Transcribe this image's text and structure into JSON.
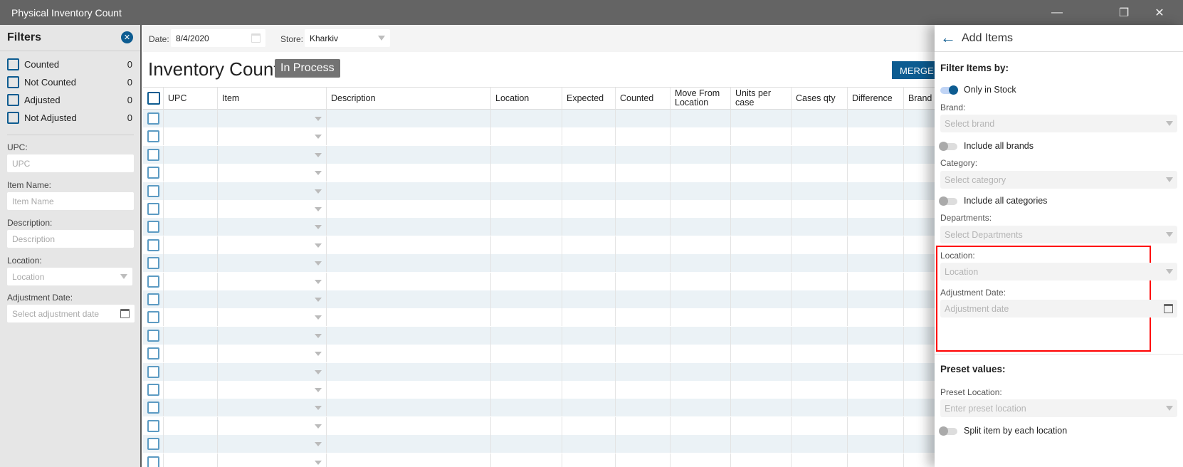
{
  "window": {
    "title": "Physical Inventory Count",
    "minimize": "—",
    "restore": "❐",
    "close": "✕"
  },
  "sidebar": {
    "title": "Filters",
    "close": "✕",
    "status_filters": [
      {
        "label": "Counted",
        "count": "0"
      },
      {
        "label": "Not Counted",
        "count": "0"
      },
      {
        "label": "Adjusted",
        "count": "0"
      },
      {
        "label": "Not Adjusted",
        "count": "0"
      }
    ],
    "fields": {
      "upc": {
        "label": "UPC:",
        "placeholder": "UPC"
      },
      "item_name": {
        "label": "Item Name:",
        "placeholder": "Item Name"
      },
      "description": {
        "label": "Description:",
        "placeholder": "Description"
      },
      "location": {
        "label": "Location:",
        "placeholder": "Location"
      },
      "adjustment_date": {
        "label": "Adjustment Date:",
        "placeholder": "Select adjustment date"
      }
    }
  },
  "toolbar": {
    "date_label": "Date:",
    "date_value": "8/4/2020",
    "store_label": "Store:",
    "store_value": "Kharkiv"
  },
  "main": {
    "title": "Inventory Count",
    "status": "In Process",
    "merge_button": "MERGE I"
  },
  "table": {
    "columns": [
      "UPC",
      "Item",
      "Description",
      "Location",
      "Expected",
      "Counted",
      "Move From Location",
      "Units per case",
      "Cases qty",
      "Difference",
      "Brand"
    ]
  },
  "panel": {
    "back": "←",
    "title": "Add Items",
    "filter_heading": "Filter Items by:",
    "only_in_stock": "Only in Stock",
    "brand_label": "Brand:",
    "brand_placeholder": "Select brand",
    "include_all_brands": "Include all brands",
    "category_label": "Category:",
    "category_placeholder": "Select category",
    "include_all_categories": "Include all categories",
    "departments_label": "Departments:",
    "departments_placeholder": "Select Departments",
    "location_label": "Location:",
    "location_placeholder": "Location",
    "adj_date_label": "Adjustment Date:",
    "adj_date_placeholder": "Adjustment date",
    "preset_heading": "Preset values:",
    "preset_location_label": "Preset Location:",
    "preset_location_placeholder": "Enter preset location",
    "split_item": "Split item by each location"
  },
  "colors": {
    "accent": "#0d5c91",
    "titlebar": "#646464",
    "highlight": "#ff0000"
  }
}
